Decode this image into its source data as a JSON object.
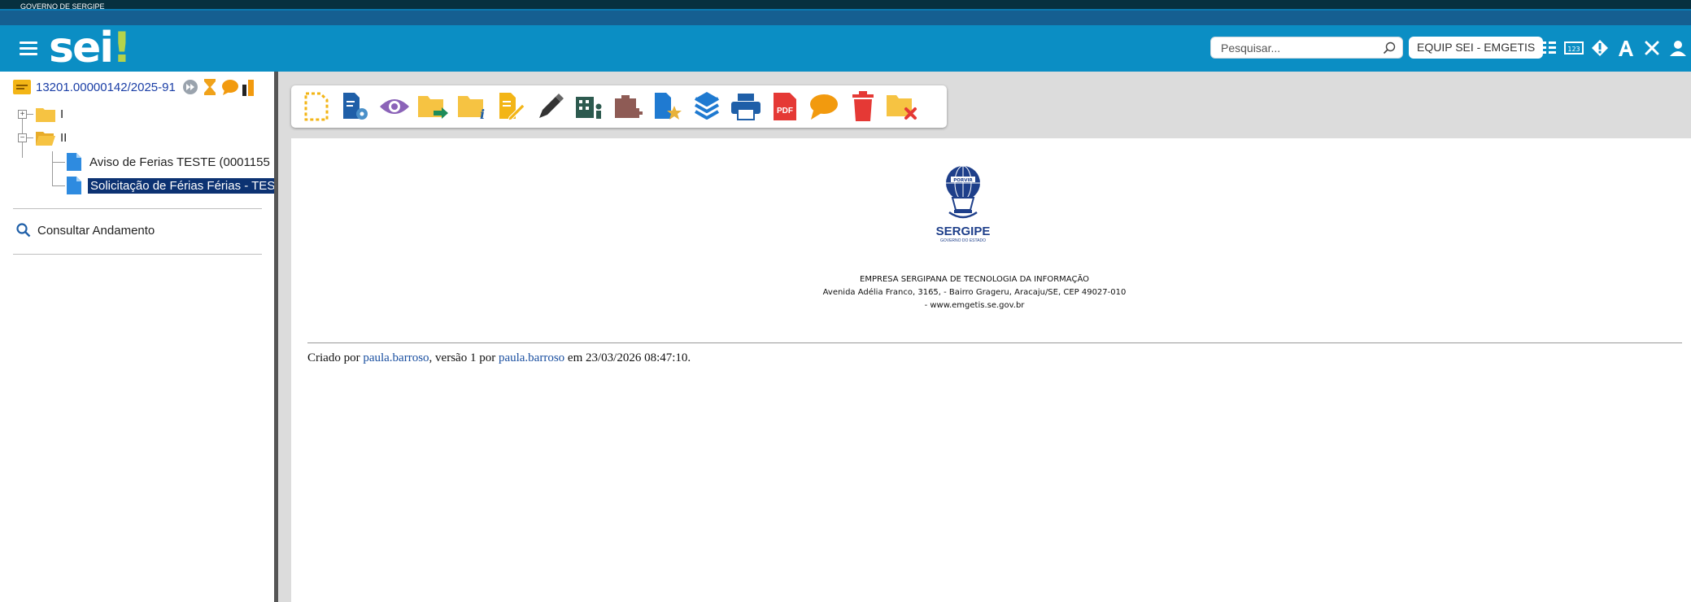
{
  "gov_bar": {
    "label": "GOVERNO DE SERGIPE"
  },
  "header": {
    "logo_text": "sei",
    "logo_mark": "!",
    "search_placeholder": "Pesquisar...",
    "unit_label": "EQUIP SEI - EMGETIS",
    "icons": [
      "list-icon",
      "numeric-icon",
      "alert-icon",
      "font-size-icon",
      "tools-icon",
      "user-icon",
      "power-icon"
    ]
  },
  "sidebar": {
    "process_number": "13201.00000142/2025-91",
    "tree": [
      {
        "label": "I",
        "type": "folder",
        "expanded": false
      },
      {
        "label": "II",
        "type": "folder",
        "expanded": true,
        "children": [
          {
            "label": "Aviso de Ferias TESTE (0001155",
            "type": "document"
          },
          {
            "label": "Solicitação de Férias Férias - TES",
            "type": "document",
            "selected": true
          }
        ]
      }
    ],
    "consult_label": "Consultar Andamento"
  },
  "toolbar": {
    "icons": [
      "new-document-icon",
      "document-settings-icon",
      "view-icon",
      "send-process-icon",
      "process-info-icon",
      "edit-document-icon",
      "sign-icon",
      "assign-icon",
      "add-block-icon",
      "bookmark-icon",
      "layers-icon",
      "print-icon",
      "pdf-icon",
      "comment-icon",
      "delete-icon",
      "cancel-document-icon"
    ],
    "pdf_label": "PDF"
  },
  "document": {
    "state_name": "SERGIPE",
    "state_sub": "GOVERNO DO ESTADO",
    "seal_motto": "PORVIR",
    "company": "EMPRESA SERGIPANA DE TECNOLOGIA DA INFORMAÇÃO",
    "address": "Avenida Adélia Franco, 3165, - Bairro Grageru, Aracaju/SE, CEP 49027-010",
    "website": "- www.emgetis.se.gov.br",
    "meta": {
      "created_by_prefix": "Criado por",
      "user1": "paula.barroso",
      "version_text": ", versão 1 por",
      "user2": "paula.barroso",
      "date_text": "em 23/03/2026 08:47:10."
    }
  },
  "colors": {
    "header": "#0b8ec4",
    "top_band": "#155f91",
    "logo_accent": "#b5d34a",
    "selection": "#0c3272",
    "folder": "#f6c342",
    "document": "#2e8be0"
  }
}
